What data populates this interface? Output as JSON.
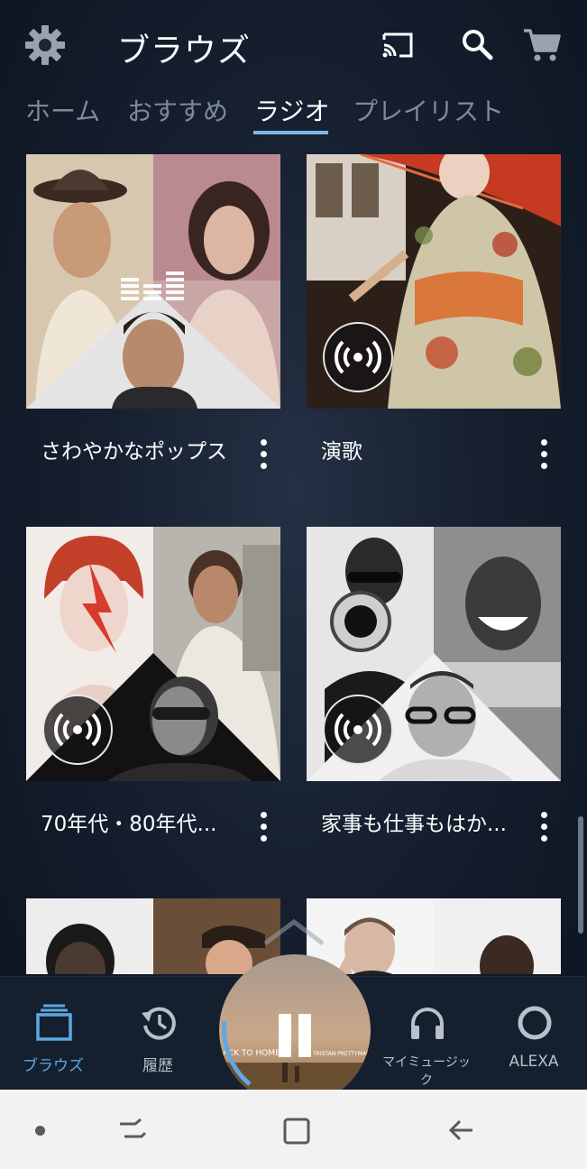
{
  "header": {
    "title": "ブラウズ",
    "icons": [
      "gear-icon",
      "cast-icon",
      "search-icon",
      "cart-icon"
    ]
  },
  "tabs": [
    {
      "label": "ホーム",
      "active": false
    },
    {
      "label": "おすすめ",
      "active": false
    },
    {
      "label": "ラジオ",
      "active": true
    },
    {
      "label": "プレイリスト",
      "active": false
    }
  ],
  "stations": [
    {
      "title": "さわやかなポップス"
    },
    {
      "title": "演歌"
    },
    {
      "title": "70年代・80年代..."
    },
    {
      "title": "家事も仕事もはか..."
    }
  ],
  "bottom_nav": [
    {
      "label": "ブラウズ",
      "icon": "browse-icon",
      "active": true
    },
    {
      "label": "履歴",
      "icon": "history-icon",
      "active": false
    },
    {
      "label": "マイミュージック",
      "icon": "headphones-icon",
      "active": false
    },
    {
      "label": "ALEXA",
      "icon": "alexa-icon",
      "active": false
    }
  ],
  "now_playing": {
    "album_text_left": "ACK TO HOME",
    "album_text_right": "TRISTAN PRETTYMAN",
    "state": "playing"
  },
  "colors": {
    "accent": "#5fa8e0",
    "tab_underline": "#7fb8e6",
    "background": "#162030"
  }
}
